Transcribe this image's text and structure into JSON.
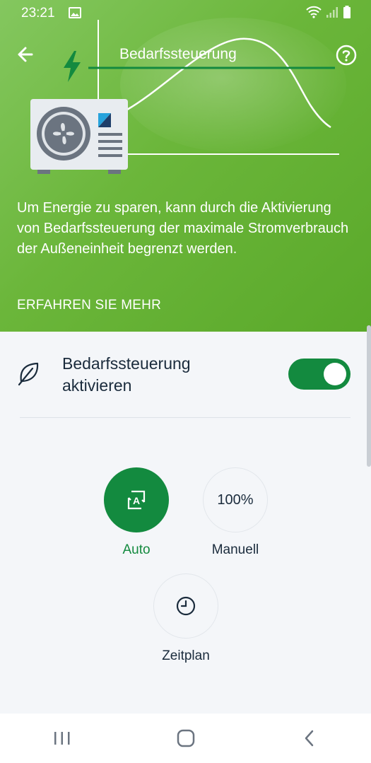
{
  "status_bar": {
    "time": "23:21"
  },
  "header": {
    "title": "Bedarfssteuerung"
  },
  "hero": {
    "description": "Um Energie zu sparen, kann durch die Aktivierung von Bedarfssteuerung der maximale Stromverbrauch der Außeneinheit begrenzt werden.",
    "learn_more": "ERFAHREN SIE MEHR"
  },
  "toggle_row": {
    "label_line1": "Bedarfssteuerung",
    "label_line2": "aktivieren",
    "enabled": true
  },
  "modes": [
    {
      "label": "Auto",
      "icon": "auto-mode-icon",
      "active": true
    },
    {
      "label": "Manuell",
      "value": "100%",
      "active": false
    },
    {
      "label": "Zeitplan",
      "icon": "clock-icon",
      "active": false
    }
  ],
  "colors": {
    "accent": "#138a3f",
    "hero_green": "#6bb63a"
  }
}
